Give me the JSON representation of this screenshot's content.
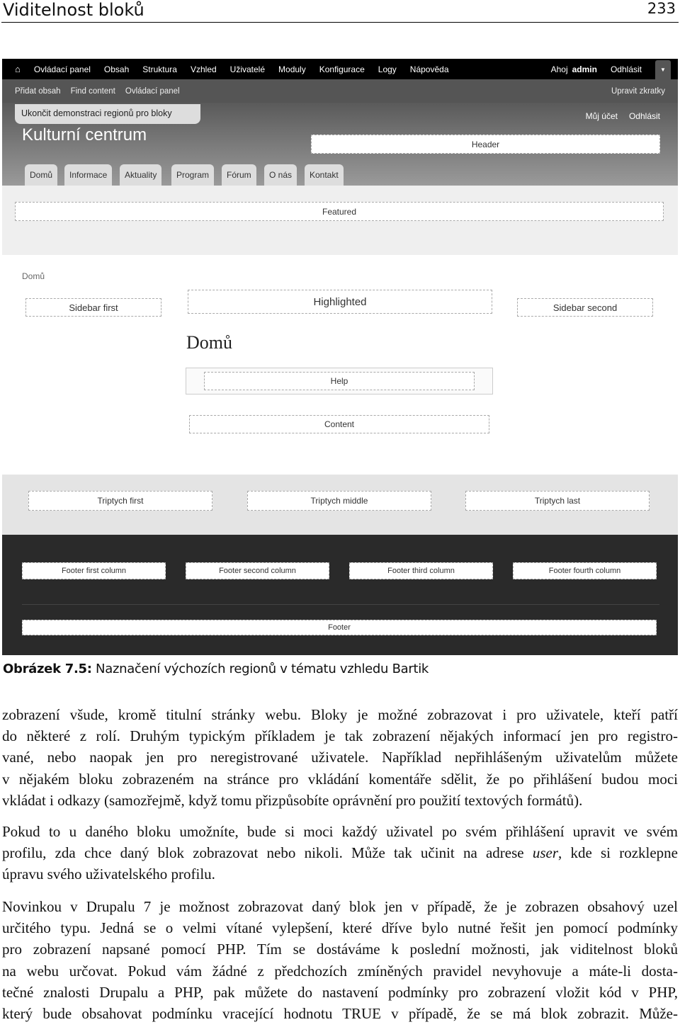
{
  "page": {
    "running_head": "Viditelnost bloků",
    "page_number": "233"
  },
  "screenshot": {
    "toolbar": {
      "items": [
        "Ovládací panel",
        "Obsah",
        "Struktura",
        "Vzhled",
        "Uživatelé",
        "Moduly",
        "Konfigurace",
        "Logy",
        "Nápověda"
      ],
      "greeting": "Ahoj",
      "user": "admin",
      "logout": "Odhlásit"
    },
    "shortcuts": {
      "items": [
        "Přidat obsah",
        "Find content",
        "Ovládací panel"
      ],
      "edit": "Upravit zkratky"
    },
    "demo_exit": "Ukončit demonstraci regionů pro bloky",
    "site_name": "Kulturní centrum",
    "secondary": [
      "Můj účet",
      "Odhlásit"
    ],
    "tabs": [
      "Domů",
      "Informace",
      "Aktuality",
      "Program",
      "Fórum",
      "O nás",
      "Kontakt"
    ],
    "regions": {
      "header": "Header",
      "featured": "Featured",
      "sidebar_first": "Sidebar first",
      "highlighted": "Highlighted",
      "sidebar_second": "Sidebar second",
      "help": "Help",
      "content": "Content",
      "triptych_first": "Triptych first",
      "triptych_middle": "Triptych middle",
      "triptych_last": "Triptych last",
      "footer_first": "Footer first column",
      "footer_second": "Footer second column",
      "footer_third": "Footer third column",
      "footer_fourth": "Footer fourth column",
      "footer": "Footer"
    },
    "breadcrumb": "Domů",
    "page_title": "Domů"
  },
  "caption": {
    "label": "Obrázek 7.5:",
    "text": " Naznačení výchozích regionů v tématu vzhledu Bartik"
  },
  "paragraphs": [
    [
      "zobrazení všude, kromě titulní stránky webu. Bloky je možné zobrazovat i pro uživatele, kteří patří",
      "do některé z rolí. Druhým typickým příkladem je tak zobrazení nějakých informací jen pro registro-",
      "vané, nebo naopak jen pro neregistrované uživatele. Například nepřihlášeným uživatelům můžete",
      "v nějakém bloku zobrazeném na stránce pro vkládání komentáře sdělit, že po přihlášení budou moci",
      "vkládat i odkazy (samozřejmě, když tomu přizpůsobíte oprávnění pro použití textových formátů)."
    ],
    [
      "Pokud to u daného bloku umožníte, bude si moci každý uživatel po svém přihlášení upravit ve svém",
      "profilu, zda chce daný blok zobrazovat nebo nikoli. Může tak učinit na adrese user, kde si rozklepne",
      "úpravu svého uživatelského profilu."
    ],
    [
      "Novinkou v Drupalu 7 je možnost zobrazovat daný blok jen v případě, že je zobrazen obsahový uzel",
      "určitého typu. Jedná se o velmi vítané vylepšení, které dříve bylo nutné řešit jen pomocí podmínky",
      "pro zobrazení napsané pomocí PHP. Tím se dostáváme k poslední možnosti, jak viditelnost bloků",
      "na webu určovat. Pokud vám žádné z předchozích zmíněných pravidel nevyhovuje a máte-li dosta-",
      "tečné znalosti Drupalu a PHP, pak můžete do nastavení podmínky pro zobrazení vložit kód v PHP,",
      "který bude obsahovat podmínku vracející hodnotu TRUE v případě, že se má blok zobrazit. Může-"
    ]
  ]
}
